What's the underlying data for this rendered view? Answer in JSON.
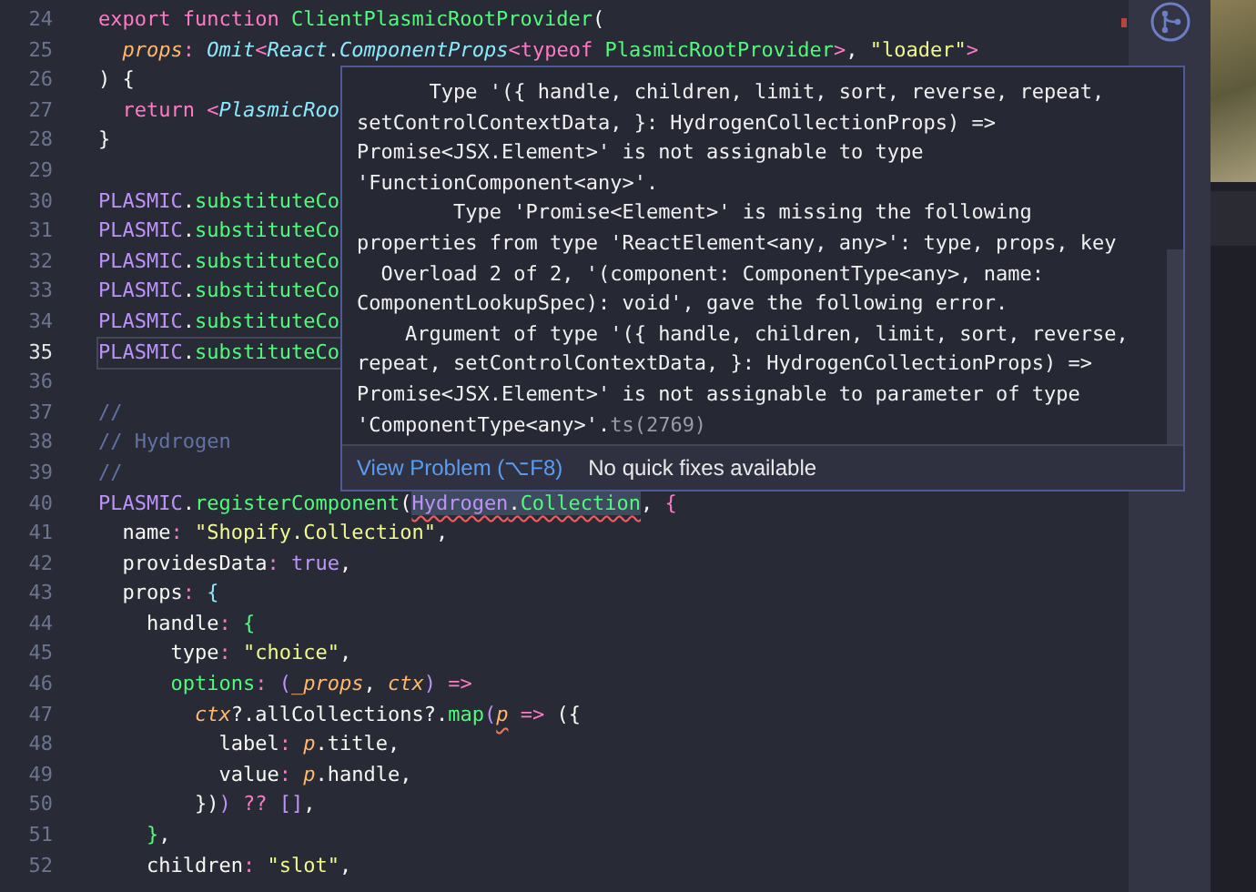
{
  "editor": {
    "lines": [
      {
        "number": "24",
        "current": false,
        "tokens": [
          {
            "text": "export function ",
            "kind": "keyword"
          },
          {
            "text": "ClientPlasmicRootProvider",
            "kind": "function"
          },
          {
            "text": "(",
            "kind": "plain"
          }
        ]
      },
      {
        "number": "25",
        "current": false,
        "tokens": [
          {
            "text": "  props",
            "kind": "parameter"
          },
          {
            "text": ": ",
            "kind": "keyword"
          },
          {
            "text": "Omit",
            "kind": "type"
          },
          {
            "text": "<",
            "kind": "keyword"
          },
          {
            "text": "React",
            "kind": "type"
          },
          {
            "text": ".",
            "kind": "plain"
          },
          {
            "text": "ComponentProps",
            "kind": "type"
          },
          {
            "text": "<",
            "kind": "keyword"
          },
          {
            "text": "typeof",
            "kind": "keyword"
          },
          {
            "text": " PlasmicRootProvider",
            "kind": "function"
          },
          {
            "text": ">",
            "kind": "keyword"
          },
          {
            "text": ", ",
            "kind": "plain"
          },
          {
            "text": "\"loader\"",
            "kind": "string"
          },
          {
            "text": ">",
            "kind": "keyword"
          }
        ]
      },
      {
        "number": "26",
        "current": false,
        "tokens": [
          {
            "text": ") {",
            "kind": "plain"
          }
        ]
      },
      {
        "number": "27",
        "current": false,
        "tokens": [
          {
            "text": "  return ",
            "kind": "keyword"
          },
          {
            "text": "<",
            "kind": "keyword"
          },
          {
            "text": "PlasmicRoo",
            "kind": "type"
          }
        ]
      },
      {
        "number": "28",
        "current": false,
        "tokens": [
          {
            "text": "}",
            "kind": "plain"
          }
        ]
      },
      {
        "number": "29",
        "current": false
      },
      {
        "number": "30",
        "current": false,
        "tokens": [
          {
            "text": "PLASMIC",
            "kind": "constant"
          },
          {
            "text": ".",
            "kind": "plain"
          },
          {
            "text": "substituteCo",
            "kind": "function"
          }
        ]
      },
      {
        "number": "31",
        "current": false,
        "tokens": [
          {
            "text": "PLASMIC",
            "kind": "constant"
          },
          {
            "text": ".",
            "kind": "plain"
          },
          {
            "text": "substituteCo",
            "kind": "function"
          }
        ]
      },
      {
        "number": "32",
        "current": false,
        "tokens": [
          {
            "text": "PLASMIC",
            "kind": "constant"
          },
          {
            "text": ".",
            "kind": "plain"
          },
          {
            "text": "substituteCo",
            "kind": "function"
          }
        ]
      },
      {
        "number": "33",
        "current": false,
        "tokens": [
          {
            "text": "PLASMIC",
            "kind": "constant"
          },
          {
            "text": ".",
            "kind": "plain"
          },
          {
            "text": "substituteCo",
            "kind": "function"
          }
        ]
      },
      {
        "number": "34",
        "current": false,
        "tokens": [
          {
            "text": "PLASMIC",
            "kind": "constant"
          },
          {
            "text": ".",
            "kind": "plain"
          },
          {
            "text": "substituteCo",
            "kind": "function"
          }
        ]
      },
      {
        "number": "35",
        "current": true,
        "tokens": [
          {
            "text": "PLASMIC",
            "kind": "constant"
          },
          {
            "text": ".",
            "kind": "plain"
          },
          {
            "text": "substituteCo",
            "kind": "function"
          }
        ]
      },
      {
        "number": "36",
        "current": false
      },
      {
        "number": "37",
        "current": false,
        "tokens": [
          {
            "text": "//",
            "kind": "comment"
          }
        ]
      },
      {
        "number": "38",
        "current": false,
        "tokens": [
          {
            "text": "// Hydrogen",
            "kind": "comment"
          }
        ]
      },
      {
        "number": "39",
        "current": false,
        "tokens": [
          {
            "text": "//",
            "kind": "comment"
          }
        ]
      },
      {
        "number": "40",
        "current": false,
        "tokens": [
          {
            "text": "PLASMIC",
            "kind": "constant"
          },
          {
            "text": ".",
            "kind": "plain"
          },
          {
            "text": "registerComponent",
            "kind": "function"
          },
          {
            "text": "(",
            "kind": "plain"
          },
          {
            "text": "Hydrogen",
            "kind": "constant",
            "error": true
          },
          {
            "text": ".",
            "kind": "plain",
            "error": true
          },
          {
            "text": "Collection",
            "kind": "function",
            "error": true
          },
          {
            "text": ", ",
            "kind": "plain"
          },
          {
            "text": "{",
            "kind": "keyword"
          }
        ]
      },
      {
        "number": "41",
        "current": false,
        "tokens": [
          {
            "text": "  name",
            "kind": "plain"
          },
          {
            "text": ": ",
            "kind": "keyword"
          },
          {
            "text": "\"Shopify.Collection\"",
            "kind": "string"
          },
          {
            "text": ",",
            "kind": "plain"
          }
        ]
      },
      {
        "number": "42",
        "current": false,
        "tokens": [
          {
            "text": "  providesData",
            "kind": "plain"
          },
          {
            "text": ": ",
            "kind": "keyword"
          },
          {
            "text": "true",
            "kind": "constant"
          },
          {
            "text": ",",
            "kind": "plain"
          }
        ]
      },
      {
        "number": "43",
        "current": false,
        "tokens": [
          {
            "text": "  props",
            "kind": "plain"
          },
          {
            "text": ": ",
            "kind": "keyword"
          },
          {
            "text": "{",
            "kind": "support"
          }
        ]
      },
      {
        "number": "44",
        "current": false,
        "tokens": [
          {
            "text": "    handle",
            "kind": "plain"
          },
          {
            "text": ": ",
            "kind": "keyword"
          },
          {
            "text": "{",
            "kind": "function"
          }
        ]
      },
      {
        "number": "45",
        "current": false,
        "tokens": [
          {
            "text": "      type",
            "kind": "plain"
          },
          {
            "text": ": ",
            "kind": "keyword"
          },
          {
            "text": "\"choice\"",
            "kind": "string"
          },
          {
            "text": ",",
            "kind": "plain"
          }
        ]
      },
      {
        "number": "46",
        "current": false,
        "tokens": [
          {
            "text": "      options",
            "kind": "function"
          },
          {
            "text": ": ",
            "kind": "keyword"
          },
          {
            "text": "(",
            "kind": "constant"
          },
          {
            "text": "_props",
            "kind": "parameter"
          },
          {
            "text": ", ",
            "kind": "plain"
          },
          {
            "text": "ctx",
            "kind": "parameter"
          },
          {
            "text": ")",
            "kind": "constant"
          },
          {
            "text": " =>",
            "kind": "keyword"
          }
        ]
      },
      {
        "number": "47",
        "current": false,
        "tokens": [
          {
            "text": "        ctx",
            "kind": "parameter"
          },
          {
            "text": "?.allCollections?.",
            "kind": "plain"
          },
          {
            "text": "map",
            "kind": "function"
          },
          {
            "text": "(",
            "kind": "constant"
          },
          {
            "text": "p",
            "kind": "parameter",
            "warning": true
          },
          {
            "text": " => ",
            "kind": "keyword"
          },
          {
            "text": "({",
            "kind": "plain"
          }
        ]
      },
      {
        "number": "48",
        "current": false,
        "tokens": [
          {
            "text": "          label",
            "kind": "plain"
          },
          {
            "text": ": ",
            "kind": "keyword"
          },
          {
            "text": "p",
            "kind": "parameter"
          },
          {
            "text": ".title,",
            "kind": "plain"
          }
        ]
      },
      {
        "number": "49",
        "current": false,
        "tokens": [
          {
            "text": "          value",
            "kind": "plain"
          },
          {
            "text": ": ",
            "kind": "keyword"
          },
          {
            "text": "p",
            "kind": "parameter"
          },
          {
            "text": ".handle,",
            "kind": "plain"
          }
        ]
      },
      {
        "number": "50",
        "current": false,
        "tokens": [
          {
            "text": "        })",
            "kind": "plain"
          },
          {
            "text": ")",
            "kind": "constant"
          },
          {
            "text": " ?? ",
            "kind": "keyword"
          },
          {
            "text": "[]",
            "kind": "constant"
          },
          {
            "text": ",",
            "kind": "plain"
          }
        ]
      },
      {
        "number": "51",
        "current": false,
        "tokens": [
          {
            "text": "    }",
            "kind": "function"
          },
          {
            "text": ",",
            "kind": "plain"
          }
        ]
      },
      {
        "number": "52",
        "current": false,
        "tokens": [
          {
            "text": "    children",
            "kind": "plain"
          },
          {
            "text": ": ",
            "kind": "keyword"
          },
          {
            "text": "\"slot\"",
            "kind": "string"
          },
          {
            "text": ",",
            "kind": "plain"
          }
        ]
      }
    ]
  },
  "hover": {
    "message_lines": [
      "      Type '({ handle, children, limit, sort, reverse, repeat,",
      "setControlContextData, }: HydrogenCollectionProps) =>",
      "Promise<JSX.Element>' is not assignable to type",
      "'FunctionComponent<any>'.",
      "        Type 'Promise<Element>' is missing the following",
      "properties from type 'ReactElement<any, any>': type, props, key",
      "  Overload 2 of 2, '(component: ComponentType<any>, name:",
      "ComponentLookupSpec): void', gave the following error.",
      "    Argument of type '({ handle, children, limit, sort, reverse,",
      "repeat, setControlContextData, }: HydrogenCollectionProps) =>",
      "Promise<JSX.Element>' is not assignable to parameter of type",
      "'ComponentType<any>'."
    ],
    "error_code": "ts(2769)",
    "actions": [
      {
        "label": "View Problem (⌥F8)",
        "kind": "link"
      },
      {
        "label": "No quick fixes available",
        "kind": "text"
      }
    ]
  }
}
